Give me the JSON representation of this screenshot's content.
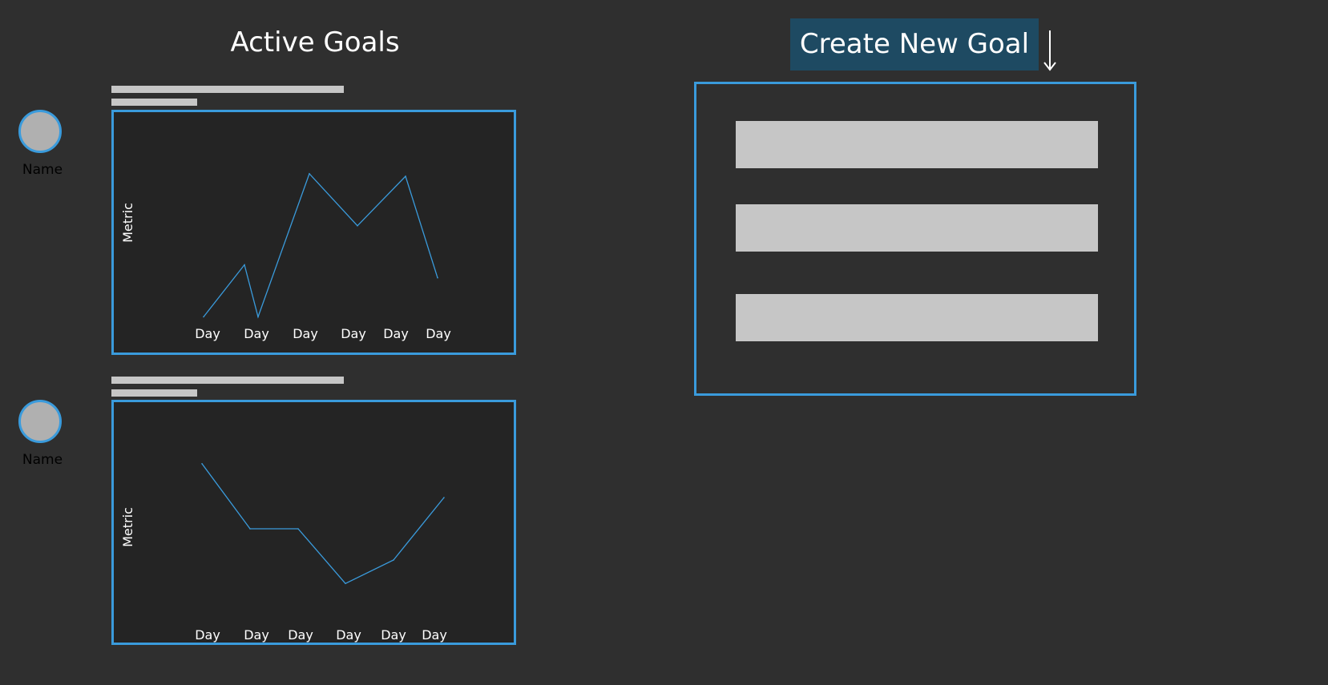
{
  "header": {
    "title": "Active Goals",
    "create_button_label": "Create New Goal",
    "create_button_icon": "arrow-down-icon"
  },
  "goals": [
    {
      "avatar_name": "Name",
      "chart_data": {
        "type": "line",
        "ylabel": "Metric",
        "x": [
          "Day",
          "Day",
          "Day",
          "Day",
          "Day",
          "Day"
        ],
        "series": [
          {
            "values": [
              1,
              3,
              1,
              6.5,
              4.5,
              6.4,
              2.5
            ]
          }
        ],
        "ylim": [
          0,
          8
        ],
        "grid": false,
        "color": "#3a9bdc"
      }
    },
    {
      "avatar_name": "Name",
      "chart_data": {
        "type": "line",
        "ylabel": "Metric",
        "x": [
          "Day",
          "Day",
          "Day",
          "Day",
          "Day",
          "Day"
        ],
        "series": [
          {
            "values": [
              6.5,
              4,
              4,
              1.9,
              2.8,
              5.2
            ]
          }
        ],
        "ylim": [
          0,
          8
        ],
        "grid": false,
        "color": "#3a9bdc"
      }
    }
  ],
  "form": {
    "fields": [
      {
        "placeholder": ""
      },
      {
        "placeholder": ""
      },
      {
        "placeholder": ""
      }
    ]
  },
  "colors": {
    "background": "#2f2f2f",
    "chart_background": "#242424",
    "accent": "#3a9bdc",
    "button_background": "#1e4a62",
    "placeholder_bar": "#c6c6c6"
  }
}
